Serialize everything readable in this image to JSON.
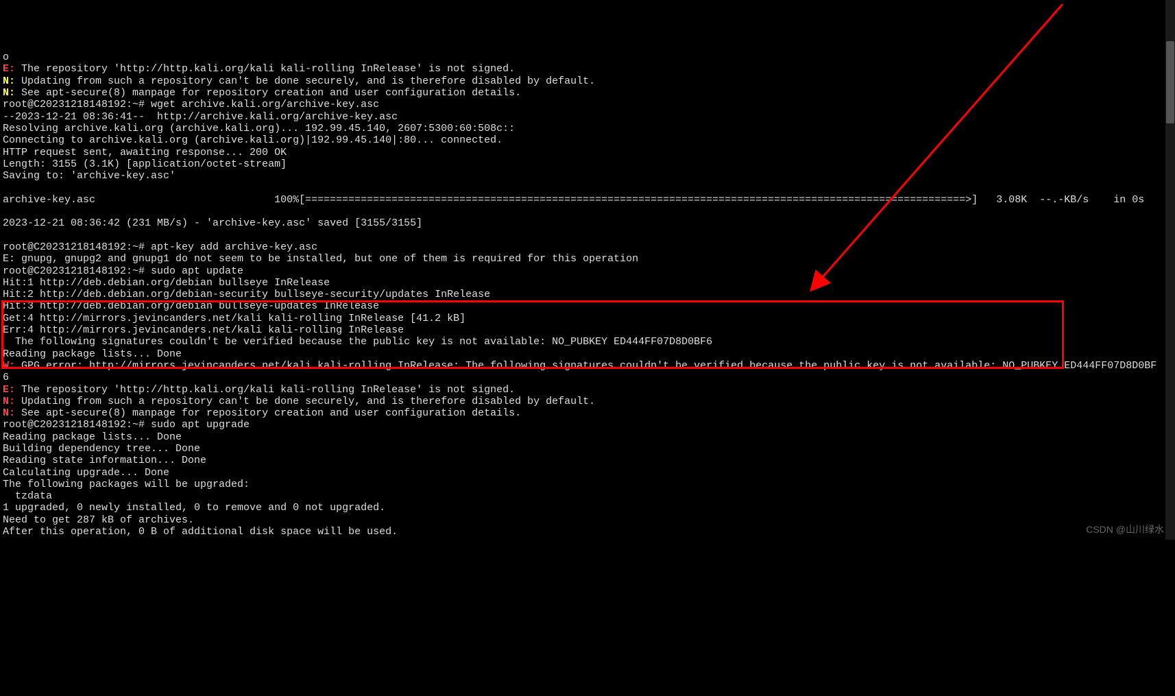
{
  "lines": [
    {
      "segs": [
        {
          "c": "white",
          "t": "o"
        }
      ]
    },
    {
      "segs": [
        {
          "c": "red",
          "t": "E:"
        },
        {
          "c": "white",
          "t": " The repository 'http://http.kali.org/kali kali-rolling InRelease' is not signed."
        }
      ]
    },
    {
      "segs": [
        {
          "c": "yellow",
          "t": "N:"
        },
        {
          "c": "white",
          "t": " Updating from such a repository can't be done securely, and is therefore disabled by default."
        }
      ]
    },
    {
      "segs": [
        {
          "c": "yellow",
          "t": "N:"
        },
        {
          "c": "white",
          "t": " See apt-secure(8) manpage for repository creation and user configuration details."
        }
      ]
    },
    {
      "segs": [
        {
          "c": "white",
          "t": "root@C20231218148192:~# wget archive.kali.org/archive-key.asc"
        }
      ]
    },
    {
      "segs": [
        {
          "c": "white",
          "t": "--2023-12-21 08:36:41--  http://archive.kali.org/archive-key.asc"
        }
      ]
    },
    {
      "segs": [
        {
          "c": "white",
          "t": "Resolving archive.kali.org (archive.kali.org)... 192.99.45.140, 2607:5300:60:508c::"
        }
      ]
    },
    {
      "segs": [
        {
          "c": "white",
          "t": "Connecting to archive.kali.org (archive.kali.org)|192.99.45.140|:80... connected."
        }
      ]
    },
    {
      "segs": [
        {
          "c": "white",
          "t": "HTTP request sent, awaiting response... 200 OK"
        }
      ]
    },
    {
      "segs": [
        {
          "c": "white",
          "t": "Length: 3155 (3.1K) [application/octet-stream]"
        }
      ]
    },
    {
      "segs": [
        {
          "c": "white",
          "t": "Saving to: 'archive-key.asc'"
        }
      ]
    },
    {
      "segs": [
        {
          "c": "white",
          "t": " "
        }
      ]
    },
    {
      "segs": [
        {
          "c": "white",
          "t": "archive-key.asc                             100%[===========================================================================================================>]   3.08K  --.-KB/s    in 0s"
        }
      ]
    },
    {
      "segs": [
        {
          "c": "white",
          "t": " "
        }
      ]
    },
    {
      "segs": [
        {
          "c": "white",
          "t": "2023-12-21 08:36:42 (231 MB/s) - 'archive-key.asc' saved [3155/3155]"
        }
      ]
    },
    {
      "segs": [
        {
          "c": "white",
          "t": " "
        }
      ]
    },
    {
      "segs": [
        {
          "c": "white",
          "t": "root@C20231218148192:~# apt-key add archive-key.asc"
        }
      ]
    },
    {
      "segs": [
        {
          "c": "white",
          "t": "E: gnupg, gnupg2 and gnupg1 do not seem to be installed, but one of them is required for this operation"
        }
      ]
    },
    {
      "segs": [
        {
          "c": "white",
          "t": "root@C20231218148192:~# sudo apt update"
        }
      ]
    },
    {
      "segs": [
        {
          "c": "white",
          "t": "Hit:1 http://deb.debian.org/debian bullseye InRelease"
        }
      ]
    },
    {
      "segs": [
        {
          "c": "white",
          "t": "Hit:2 http://deb.debian.org/debian-security bullseye-security/updates InRelease"
        }
      ]
    },
    {
      "segs": [
        {
          "c": "white",
          "t": "Hit:3 http://deb.debian.org/debian bullseye-updates InRelease"
        }
      ]
    },
    {
      "segs": [
        {
          "c": "white",
          "t": "Get:4 http://mirrors.jevincanders.net/kali kali-rolling InRelease [41.2 kB]"
        }
      ]
    },
    {
      "segs": [
        {
          "c": "white",
          "t": "Err:4 http://mirrors.jevincanders.net/kali kali-rolling InRelease"
        }
      ]
    },
    {
      "segs": [
        {
          "c": "white",
          "t": "  The following signatures couldn't be verified because the public key is not available: NO_PUBKEY ED444FF07D8D0BF6"
        }
      ]
    },
    {
      "segs": [
        {
          "c": "white",
          "t": "Reading package lists... Done"
        }
      ]
    },
    {
      "segs": [
        {
          "c": "red",
          "t": "W:"
        },
        {
          "c": "white",
          "t": " GPG error: http://mirrors.jevincanders.net/kali kali-rolling InRelease: The following signatures couldn't be verified because the public key is not available: NO_PUBKEY ED444FF07D8D0BF"
        }
      ]
    },
    {
      "segs": [
        {
          "c": "white",
          "t": "6"
        }
      ]
    },
    {
      "segs": [
        {
          "c": "red",
          "t": "E:"
        },
        {
          "c": "white",
          "t": " The repository 'http://http.kali.org/kali kali-rolling InRelease' is not signed."
        }
      ]
    },
    {
      "segs": [
        {
          "c": "red",
          "t": "N:"
        },
        {
          "c": "white",
          "t": " Updating from such a repository can't be done securely, and is therefore disabled by default."
        }
      ]
    },
    {
      "segs": [
        {
          "c": "red",
          "t": "N:"
        },
        {
          "c": "white",
          "t": " See apt-secure(8) manpage for repository creation and user configuration details."
        }
      ]
    },
    {
      "segs": [
        {
          "c": "white",
          "t": "root@C20231218148192:~# sudo apt upgrade"
        }
      ]
    },
    {
      "segs": [
        {
          "c": "white",
          "t": "Reading package lists... Done"
        }
      ]
    },
    {
      "segs": [
        {
          "c": "white",
          "t": "Building dependency tree... Done"
        }
      ]
    },
    {
      "segs": [
        {
          "c": "white",
          "t": "Reading state information... Done"
        }
      ]
    },
    {
      "segs": [
        {
          "c": "white",
          "t": "Calculating upgrade... Done"
        }
      ]
    },
    {
      "segs": [
        {
          "c": "white",
          "t": "The following packages will be upgraded:"
        }
      ]
    },
    {
      "segs": [
        {
          "c": "white",
          "t": "  tzdata"
        }
      ]
    },
    {
      "segs": [
        {
          "c": "white",
          "t": "1 upgraded, 0 newly installed, 0 to remove and 0 not upgraded."
        }
      ]
    },
    {
      "segs": [
        {
          "c": "white",
          "t": "Need to get 287 kB of archives."
        }
      ]
    },
    {
      "segs": [
        {
          "c": "white",
          "t": "After this operation, 0 B of additional disk space will be used."
        }
      ]
    }
  ],
  "watermark": "CSDN @山川绿水"
}
